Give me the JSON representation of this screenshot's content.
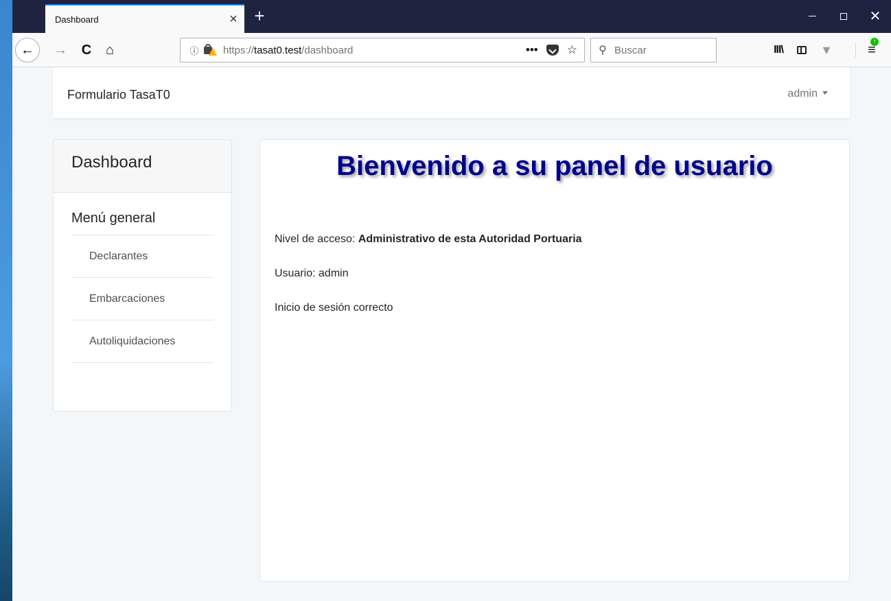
{
  "browser": {
    "tab_title": "Dashboard",
    "tab_close": "×",
    "new_tab": "+",
    "window_close": "✕",
    "url": {
      "scheme": "https://",
      "host": "tasat0.test",
      "path": "/dashboard"
    },
    "page_actions": "•••",
    "bookmark_star": "☆",
    "search_placeholder": "Buscar",
    "accent_color": "#0a84ff"
  },
  "site": {
    "brand": "Formulario TasaT0",
    "user_menu": "admin"
  },
  "sidebar": {
    "header": "Dashboard",
    "menu_title": "Menú general",
    "items": [
      {
        "label": "Declarantes"
      },
      {
        "label": "Embarcaciones"
      },
      {
        "label": "Autoliquidaciones"
      }
    ]
  },
  "main": {
    "title": "Bienvenido a su panel de usuario",
    "title_color": "#00008b",
    "access_label": "Nivel de acceso: ",
    "access_value": "Administrativo de esta Autoridad Portuaria",
    "user_line": "Usuario: admin",
    "session_line": "Inicio de sesión correcto"
  }
}
